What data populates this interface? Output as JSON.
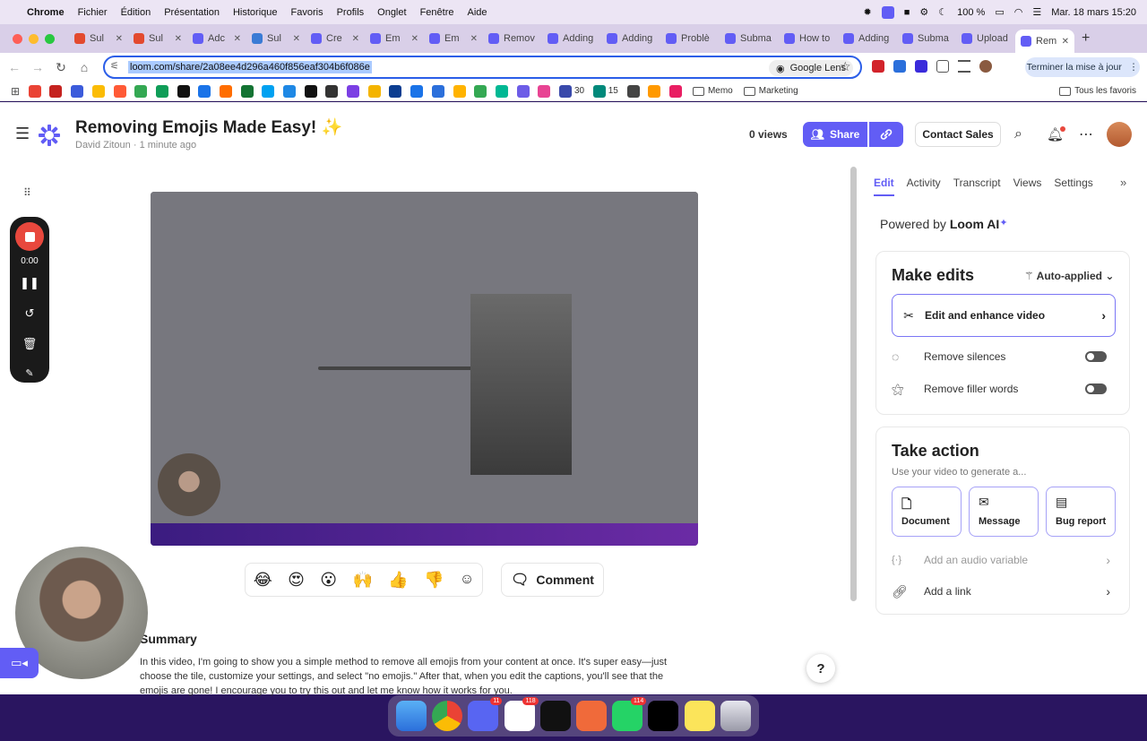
{
  "menubar": {
    "app": "Chrome",
    "items": [
      "Fichier",
      "Édition",
      "Présentation",
      "Historique",
      "Favoris",
      "Profils",
      "Onglet",
      "Fenêtre",
      "Aide"
    ],
    "battery": "100 %",
    "datetime": "Mar. 18 mars  15:20"
  },
  "tabs": [
    {
      "label": "Sul",
      "color": "#e34a2f"
    },
    {
      "label": "Sul",
      "color": "#e34a2f"
    },
    {
      "label": "Adc",
      "color": "#625df5"
    },
    {
      "label": "Sul",
      "color": "#3a7bd5"
    },
    {
      "label": "Cre",
      "color": "#625df5"
    },
    {
      "label": "Em",
      "color": "#625df5"
    },
    {
      "label": "Em",
      "color": "#625df5"
    },
    {
      "label": "Remov",
      "color": "#625df5"
    },
    {
      "label": "Adding",
      "color": "#625df5"
    },
    {
      "label": "Adding",
      "color": "#625df5"
    },
    {
      "label": "Problè",
      "color": "#625df5"
    },
    {
      "label": "Subma",
      "color": "#625df5"
    },
    {
      "label": "How to",
      "color": "#625df5"
    },
    {
      "label": "Adding",
      "color": "#625df5"
    },
    {
      "label": "Subma",
      "color": "#625df5"
    },
    {
      "label": "Upload",
      "color": "#625df5"
    },
    {
      "label": "Rem",
      "color": "#625df5",
      "active": true
    }
  ],
  "address": {
    "url": "loom.com/share/2a08ee4d296a460f856eaf304b6f086e",
    "lens": "Google Lens",
    "update": "Terminer la mise à jour"
  },
  "bookmarks": {
    "count1": "30",
    "count2": "15",
    "folders": [
      "Memo",
      "Marketing"
    ],
    "all": "Tous les favoris"
  },
  "header": {
    "title": "Removing Emojis Made Easy! ✨",
    "author": "David Zitoun",
    "time": "1 minute ago",
    "views": "0 views",
    "share": "Share",
    "contact": "Contact Sales"
  },
  "recorder": {
    "time": "0:00"
  },
  "reactions": [
    "😂",
    "😍",
    "😮",
    "🙌",
    "👍",
    "👎"
  ],
  "comment": "Comment",
  "summary": {
    "title": "Summary",
    "text": "In this video, I'm going to show you a simple method to remove all emojis from your content at once. It's super easy—just choose the tile, customize your settings, and select \"no emojis.\" After that, when you edit the captions, you'll see that the emojis are gone! I encourage you to try this out and let me know how it works for you."
  },
  "help": "?",
  "sidebar": {
    "tabs": [
      "Edit",
      "Activity",
      "Transcript",
      "Views",
      "Settings"
    ],
    "powered_prefix": "Powered by",
    "powered_brand": "Loom AI",
    "make_edits": {
      "title": "Make edits",
      "auto": "Auto-applied",
      "enhance": "Edit and enhance video",
      "silences": "Remove silences",
      "filler": "Remove filler words"
    },
    "take_action": {
      "title": "Take action",
      "sub": "Use your video to generate a...",
      "buttons": [
        "Document",
        "Message",
        "Bug report"
      ],
      "audio_var": "Add an audio variable",
      "link": "Add a link"
    }
  },
  "dock": {
    "badges": [
      "11",
      "118",
      "114"
    ]
  }
}
